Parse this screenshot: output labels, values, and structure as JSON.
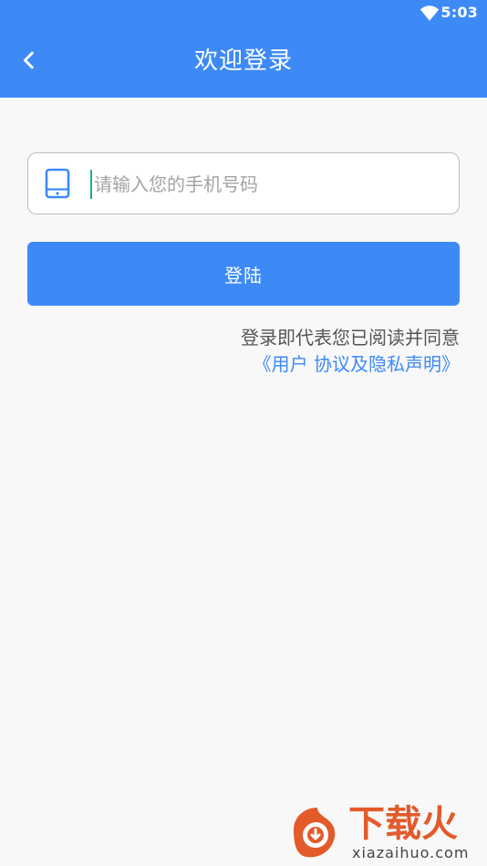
{
  "status_bar": {
    "time": "5:03",
    "icons": [
      "wifi-icon"
    ]
  },
  "header": {
    "title": "欢迎登录",
    "back_icon": "chevron-left-icon"
  },
  "form": {
    "phone_placeholder": "请输入您的手机号码",
    "phone_value": "",
    "phone_icon": "tablet-icon",
    "login_label": "登陆"
  },
  "agreement": {
    "text": "登录即代表您已阅读并同意",
    "link": "《用户 协议及隐私声明》"
  },
  "watermark": {
    "brand": "下载火",
    "site": "xiazaihuo.com"
  },
  "colors": {
    "primary": "#3d8af7",
    "background": "#f8f8f8",
    "placeholder": "#a3a3a3",
    "text_gray": "#555555",
    "brand_orange": "#e35a2b"
  }
}
